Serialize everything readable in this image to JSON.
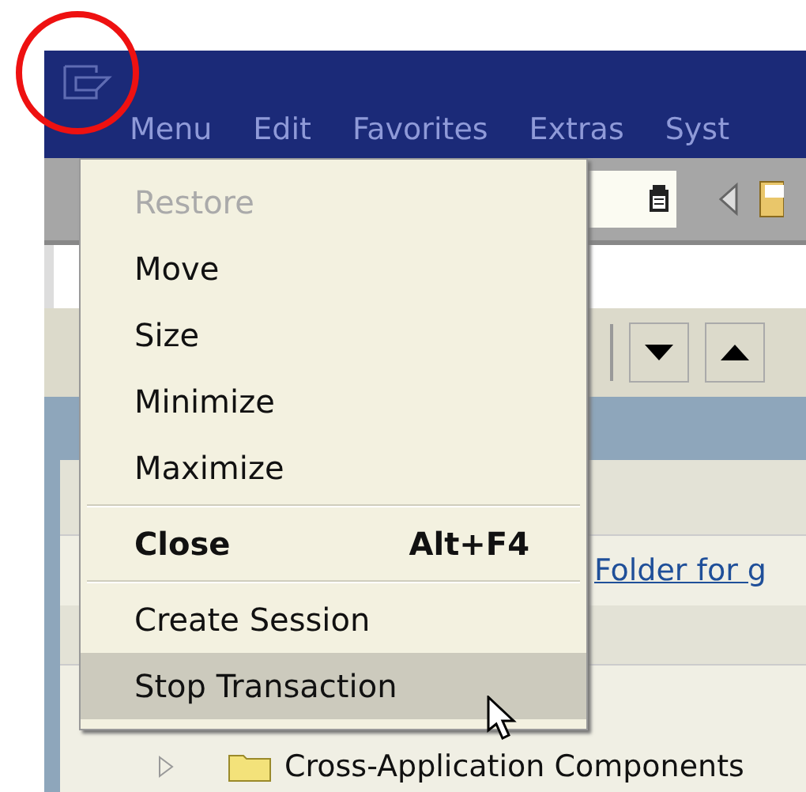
{
  "menu_bar": [
    {
      "label": "Menu"
    },
    {
      "label": "Edit"
    },
    {
      "label": "Favorites"
    },
    {
      "label": "Extras"
    },
    {
      "label": "Syst"
    }
  ],
  "content": {
    "link_text": "Folder for g",
    "tree": [
      {
        "label": "Cross-Application Components",
        "expanded": false
      }
    ]
  },
  "system_menu": [
    {
      "kind": "item",
      "label": "Restore",
      "disabled": true,
      "selected": false
    },
    {
      "kind": "item",
      "label": "Move",
      "disabled": false,
      "selected": false
    },
    {
      "kind": "item",
      "label": "Size",
      "disabled": false,
      "selected": false
    },
    {
      "kind": "item",
      "label": "Minimize",
      "disabled": false,
      "selected": false
    },
    {
      "kind": "item",
      "label": "Maximize",
      "disabled": false,
      "selected": false
    },
    {
      "kind": "separator"
    },
    {
      "kind": "item",
      "label": "Close",
      "shortcut": "Alt+F4",
      "bold": true,
      "disabled": false,
      "selected": false
    },
    {
      "kind": "separator"
    },
    {
      "kind": "item",
      "label": "Create Session",
      "disabled": false,
      "selected": false
    },
    {
      "kind": "item",
      "label": "Stop Transaction",
      "disabled": false,
      "selected": true
    }
  ]
}
